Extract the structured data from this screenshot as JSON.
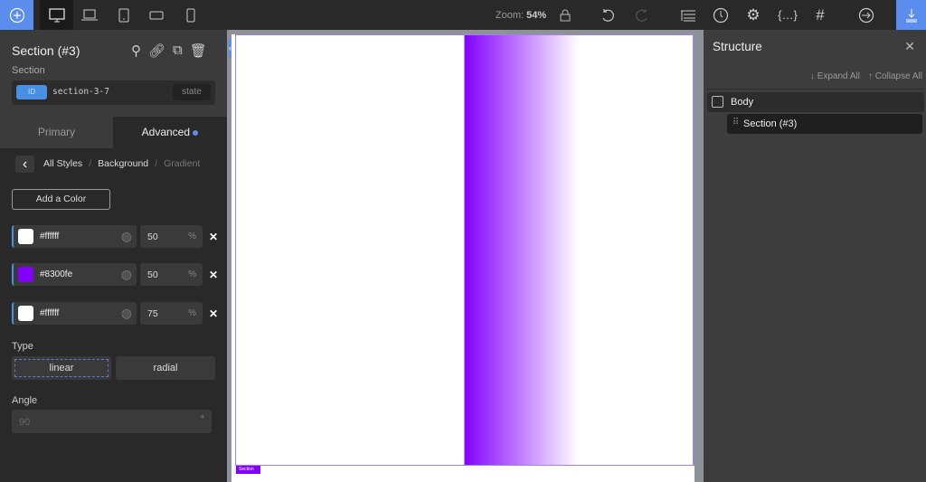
{
  "toolbar": {
    "zoom_label": "Zoom:",
    "zoom_value": "54%",
    "accent": "#5b8def"
  },
  "element": {
    "title": "Section (#3)",
    "type": "Section",
    "id_badge": "ID",
    "id_value": "section-3-7",
    "state_label": "state"
  },
  "tabs": [
    {
      "label": "Primary"
    },
    {
      "label": "Advanced"
    }
  ],
  "breadcrumb": {
    "items": [
      "All Styles",
      "Background",
      "Gradient"
    ]
  },
  "gradient": {
    "add_color_label": "Add a Color",
    "stops": [
      {
        "color": "#ffffff",
        "position": "50",
        "unit": "%"
      },
      {
        "color": "#8300fe",
        "position": "50",
        "unit": "%"
      },
      {
        "color": "#ffffff",
        "position": "75",
        "unit": "%"
      }
    ],
    "type_label": "Type",
    "types": [
      "linear",
      "radial"
    ],
    "selected_type": "linear",
    "angle_label": "Angle",
    "angle_placeholder": "90",
    "angle_unit": "°"
  },
  "canvas": {
    "section_tag": "Section"
  },
  "structure": {
    "title": "Structure",
    "expand_all": "↓ Expand All",
    "collapse_all": "↑ Collapse All",
    "tree": [
      {
        "label": "Body"
      },
      {
        "label": "Section (#3)"
      }
    ]
  }
}
